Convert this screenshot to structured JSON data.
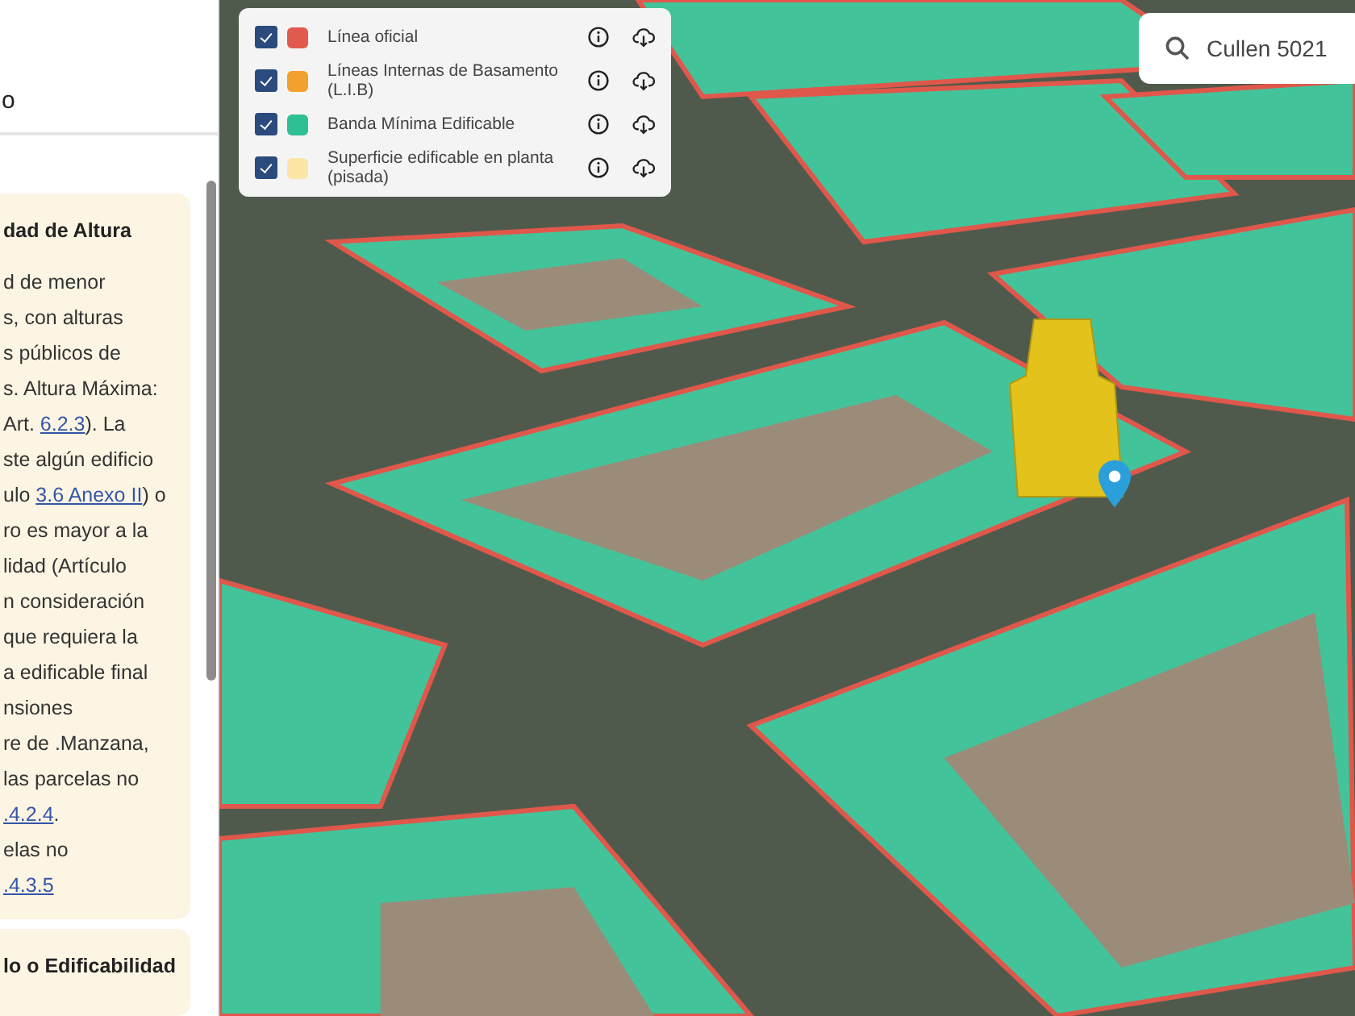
{
  "sidebar": {
    "header": "o",
    "cards": [
      {
        "title": "dad de Altura",
        "lines": [
          [
            {
              "kind": "text",
              "text": "d de menor"
            }
          ],
          [
            {
              "kind": "text",
              "text": "s, con alturas"
            }
          ],
          [
            {
              "kind": "text",
              "text": "s públicos de"
            }
          ],
          [
            {
              "kind": "text",
              "text": "s. Altura Máxima:"
            }
          ],
          [
            {
              "kind": "text",
              "text": "Art. "
            },
            {
              "kind": "link",
              "text": "6.2.3"
            },
            {
              "kind": "text",
              "text": "). La"
            }
          ],
          [
            {
              "kind": "text",
              "text": "ste algún edificio"
            }
          ],
          [
            {
              "kind": "text",
              "text": "ulo "
            },
            {
              "kind": "link",
              "text": "3.6 Anexo II"
            },
            {
              "kind": "text",
              "text": ") o"
            }
          ],
          [
            {
              "kind": "text",
              "text": "ro es mayor a la"
            }
          ],
          [
            {
              "kind": "text",
              "text": "lidad (Artículo"
            }
          ],
          [
            {
              "kind": "text",
              "text": "n consideración"
            }
          ],
          [
            {
              "kind": "text",
              "text": "que requiera la"
            }
          ],
          [
            {
              "kind": "text",
              "text": "a edificable final"
            }
          ],
          [
            {
              "kind": "text",
              "text": "nsiones"
            }
          ],
          [
            {
              "kind": "text",
              "text": "re de .Manzana,"
            }
          ],
          [
            {
              "kind": "text",
              "text": "las parcelas no"
            }
          ],
          [
            {
              "kind": "link",
              "text": ".4.2.4"
            },
            {
              "kind": "text",
              "text": "."
            }
          ],
          [
            {
              "kind": "text",
              "text": "elas no"
            }
          ],
          [
            {
              "kind": "link",
              "text": ".4.3.5"
            }
          ]
        ]
      },
      {
        "title": "lo o Edificabilidad"
      }
    ]
  },
  "legend": [
    {
      "label": "Línea oficial",
      "checked": true,
      "color": "#e05a4e"
    },
    {
      "label": "Líneas Internas de Basamento (L.I.B)",
      "checked": true,
      "color": "#f2a12e"
    },
    {
      "label": "Banda Mínima Edificable",
      "checked": true,
      "color": "#2fbf94"
    },
    {
      "label": "Superficie edificable en planta (pisada)",
      "checked": true,
      "color": "#fbe6a6"
    }
  ],
  "search": {
    "value": "Cullen 5021"
  }
}
